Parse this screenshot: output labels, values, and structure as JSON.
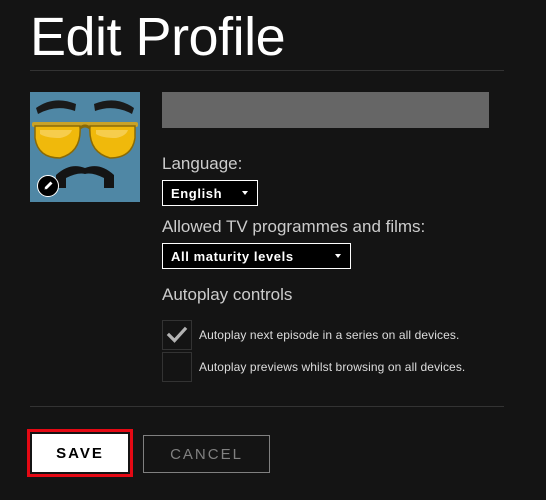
{
  "header": {
    "title": "Edit Profile"
  },
  "profile": {
    "avatar_icon": "sunglasses-mustache-avatar",
    "edit_icon": "pencil-icon",
    "name_value": "",
    "name_placeholder": ""
  },
  "language": {
    "label": "Language:",
    "selected": "English"
  },
  "maturity": {
    "label": "Allowed TV programmes and films:",
    "selected": "All maturity levels"
  },
  "autoplay": {
    "heading": "Autoplay controls",
    "options": [
      {
        "label": "Autoplay next episode in a series on all devices.",
        "checked": true
      },
      {
        "label": "Autoplay previews whilst browsing on all devices.",
        "checked": false
      }
    ]
  },
  "actions": {
    "save_label": "SAVE",
    "cancel_label": "CANCEL"
  },
  "colors": {
    "background": "#141414",
    "accent": "#e50914",
    "input_bg": "#666666"
  }
}
